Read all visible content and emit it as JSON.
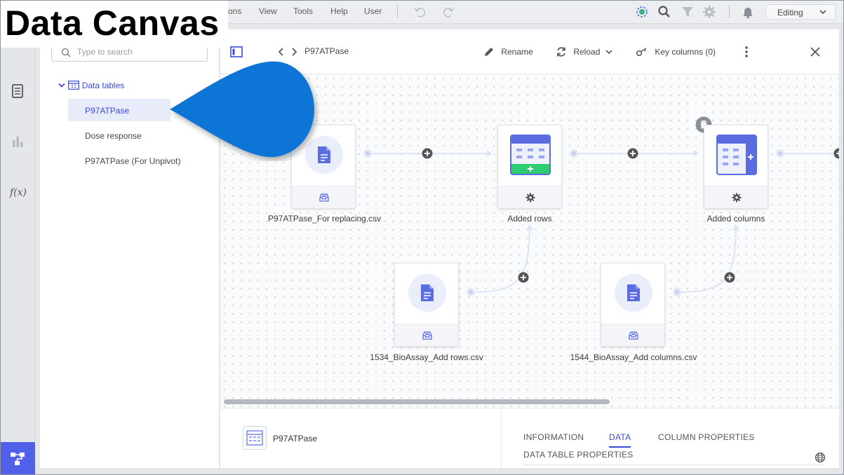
{
  "callout": {
    "title": "Data Canvas"
  },
  "menubar": {
    "items": [
      "ons",
      "View",
      "Tools",
      "Help",
      "User"
    ],
    "mode": "Editing"
  },
  "tree": {
    "search_placeholder": "Type to search",
    "root": "Data tables",
    "items": [
      "P97ATPase",
      "Dose response",
      "P97ATPase (For Unpivot)"
    ],
    "selected_index": 0
  },
  "toolbar": {
    "current": "P97ATPase",
    "rename": "Rename",
    "reload": "Reload",
    "key_columns": "Key columns (0)"
  },
  "canvas": {
    "nodes": [
      {
        "label": "P97ATPase_For replacing.csv",
        "kind": "source"
      },
      {
        "label": "Added rows",
        "kind": "add-rows"
      },
      {
        "label": "Added columns",
        "kind": "add-columns"
      },
      {
        "label": "1534_BioAssay_Add rows.csv",
        "kind": "source"
      },
      {
        "label": "1544_BioAssay_Add columns.csv",
        "kind": "source"
      }
    ]
  },
  "details": {
    "table_name": "P97ATPase",
    "tabs": [
      "INFORMATION",
      "DATA",
      "COLUMN PROPERTIES",
      "DATA TABLE PROPERTIES"
    ],
    "active_tab": "DATA"
  },
  "colors": {
    "accent": "#3b4bd8",
    "callout": "#0a74d6",
    "rail_active": "#5160e8",
    "add_green": "#2ecc71"
  }
}
